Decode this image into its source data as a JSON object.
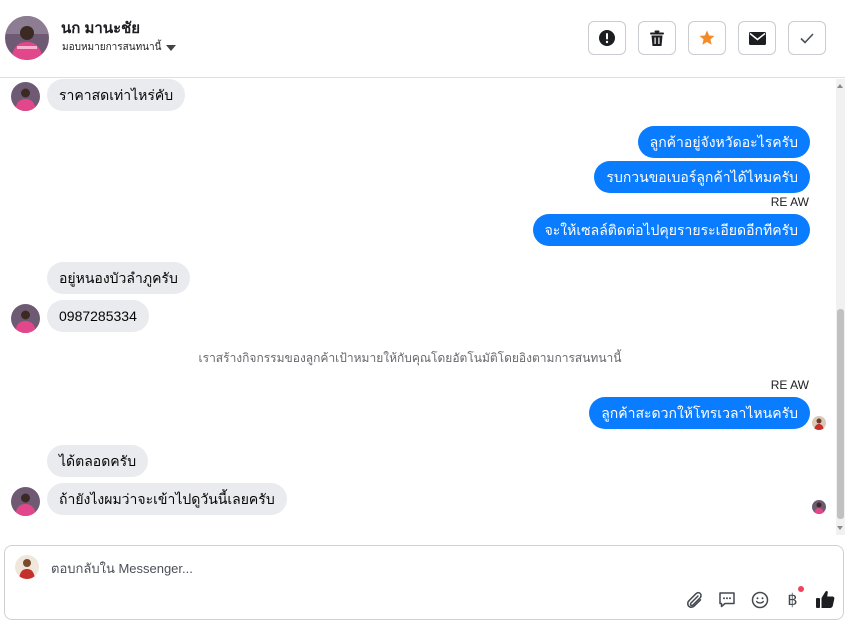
{
  "header": {
    "contact_name": "นก มานะชัย",
    "assign_label": "มอบหมายการสนทนานี้",
    "actions": [
      {
        "name": "mark-spam-button",
        "icon": "exclamation-icon"
      },
      {
        "name": "delete-button",
        "icon": "trash-icon"
      },
      {
        "name": "star-button",
        "icon": "star-icon"
      },
      {
        "name": "mark-unread-button",
        "icon": "envelope-icon"
      },
      {
        "name": "mark-done-button",
        "icon": "check-icon"
      }
    ]
  },
  "messages": [
    {
      "side": "in",
      "text": "ราคาสดเท่าไหร่คับ"
    },
    {
      "side": "out",
      "text": "ลูกค้าอยู่จังหวัดอะไรครับ"
    },
    {
      "side": "out",
      "text": "รบกวนขอเบอร์ลูกค้าได้ไหมครับ"
    },
    {
      "side": "tag",
      "text": "RE AW"
    },
    {
      "side": "out",
      "text": "จะให้เซลล์ติดต่อไปคุยรายระเอียดอีกทีครับ"
    },
    {
      "side": "in",
      "text": "อยู่หนองบัวลำภูครับ"
    },
    {
      "side": "in",
      "text": "0987285334"
    },
    {
      "side": "system",
      "text": "เราสร้างกิจกรรมของลูกค้าเป้าหมายให้กับคุณโดยอัตโนมัติโดยอิงตามการสนทนานี้"
    },
    {
      "side": "tag",
      "text": "RE AW"
    },
    {
      "side": "out",
      "text": "ลูกค้าสะดวกให้โทรเวลาไหนครับ"
    },
    {
      "side": "in",
      "text": "ได้ตลอดครับ"
    },
    {
      "side": "in",
      "text": "ถ้ายังไงผมว่าจะเข้าไปดูวันนี้เลยครับ"
    }
  ],
  "composer": {
    "placeholder": "ตอบกลับใน Messenger...",
    "currency_symbol": "฿"
  },
  "colors": {
    "outgoing_bubble": "#0a7cff",
    "incoming_bubble": "#e9ebee",
    "star": "#f28c28",
    "notification_dot": "#f3425f"
  }
}
